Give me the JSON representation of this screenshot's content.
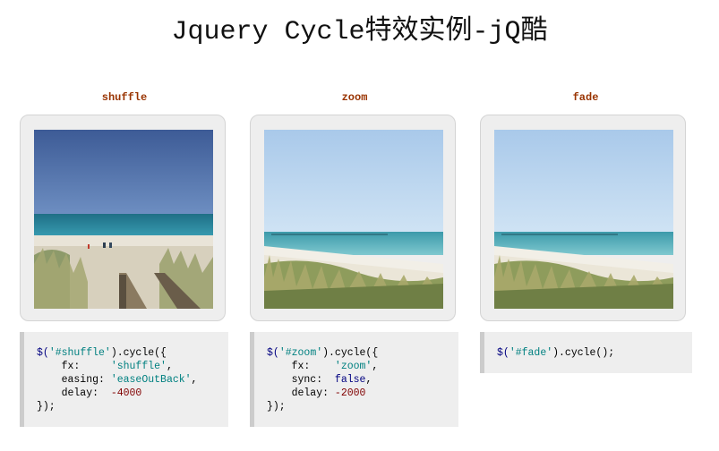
{
  "page": {
    "title": "Jquery Cycle特效实例-jQ酷"
  },
  "demos": [
    {
      "label": "shuffle",
      "image": "beach-boardwalk-photo",
      "code": {
        "l1_dollar": "$(",
        "l1_sel": "'#shuffle'",
        "l1_end": ").cycle({",
        "l2_key": "    fx:     ",
        "l2_val": "'shuffle'",
        "l2_end": ",",
        "l3_key": "    easing: ",
        "l3_val": "'easeOutBack'",
        "l3_end": ",",
        "l4_key": "    delay:  ",
        "l4_val": "-4000",
        "l5": "});"
      }
    },
    {
      "label": "zoom",
      "image": "beach-dunes-photo",
      "code": {
        "l1_dollar": "$(",
        "l1_sel": "'#zoom'",
        "l1_end": ").cycle({",
        "l2_key": "    fx:    ",
        "l2_val": "'zoom'",
        "l2_end": ",",
        "l3_key": "    sync:  ",
        "l3_val": "false",
        "l3_end": ",",
        "l4_key": "    delay: ",
        "l4_val": "-2000",
        "l5": "});"
      }
    },
    {
      "label": "fade",
      "image": "beach-dunes-photo",
      "code": {
        "l1_dollar": "$(",
        "l1_sel": "'#fade'",
        "l1_end": ").cycle();"
      }
    }
  ],
  "colors": {
    "label": "#993300",
    "frame_bg": "#eeeeee",
    "code_bg": "#eeeeee",
    "code_border": "#cccccc",
    "string": "#008080",
    "number": "#800000",
    "keyword": "#000080"
  }
}
